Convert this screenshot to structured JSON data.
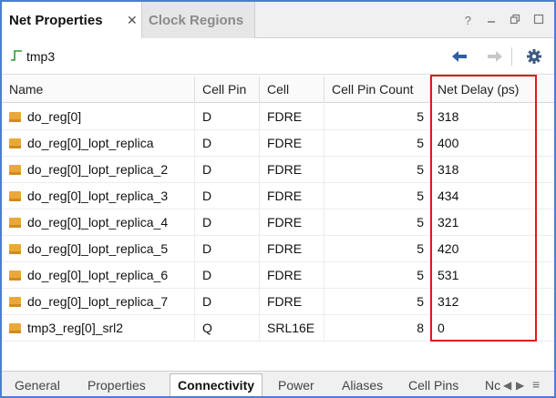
{
  "tabs": {
    "active": "Net Properties",
    "close": "✕",
    "inactive": "Clock Regions",
    "help": "?"
  },
  "toolbar": {
    "net_name": "tmp3"
  },
  "table": {
    "columns": [
      "Name",
      "Cell Pin",
      "Cell",
      "Cell Pin Count",
      "Net Delay (ps)"
    ],
    "rows": [
      {
        "name": "do_reg[0]",
        "cell_pin": "D",
        "cell": "FDRE",
        "count": "5",
        "delay": "318"
      },
      {
        "name": "do_reg[0]_lopt_replica",
        "cell_pin": "D",
        "cell": "FDRE",
        "count": "5",
        "delay": "400"
      },
      {
        "name": "do_reg[0]_lopt_replica_2",
        "cell_pin": "D",
        "cell": "FDRE",
        "count": "5",
        "delay": "318"
      },
      {
        "name": "do_reg[0]_lopt_replica_3",
        "cell_pin": "D",
        "cell": "FDRE",
        "count": "5",
        "delay": "434"
      },
      {
        "name": "do_reg[0]_lopt_replica_4",
        "cell_pin": "D",
        "cell": "FDRE",
        "count": "5",
        "delay": "321"
      },
      {
        "name": "do_reg[0]_lopt_replica_5",
        "cell_pin": "D",
        "cell": "FDRE",
        "count": "5",
        "delay": "420"
      },
      {
        "name": "do_reg[0]_lopt_replica_6",
        "cell_pin": "D",
        "cell": "FDRE",
        "count": "5",
        "delay": "531"
      },
      {
        "name": "do_reg[0]_lopt_replica_7",
        "cell_pin": "D",
        "cell": "FDRE",
        "count": "5",
        "delay": "312"
      },
      {
        "name": "tmp3_reg[0]_srl2",
        "cell_pin": "Q",
        "cell": "SRL16E",
        "count": "8",
        "delay": "0"
      }
    ]
  },
  "bottom_tabs": {
    "items": [
      "General",
      "Properties",
      "Connectivity",
      "Power",
      "Aliases",
      "Cell Pins",
      "Nc"
    ],
    "active": "Connectivity"
  },
  "colors": {
    "highlight": "#e01a1a",
    "frame": "#4a7fd0",
    "cell_icon": "#e9a93a"
  }
}
